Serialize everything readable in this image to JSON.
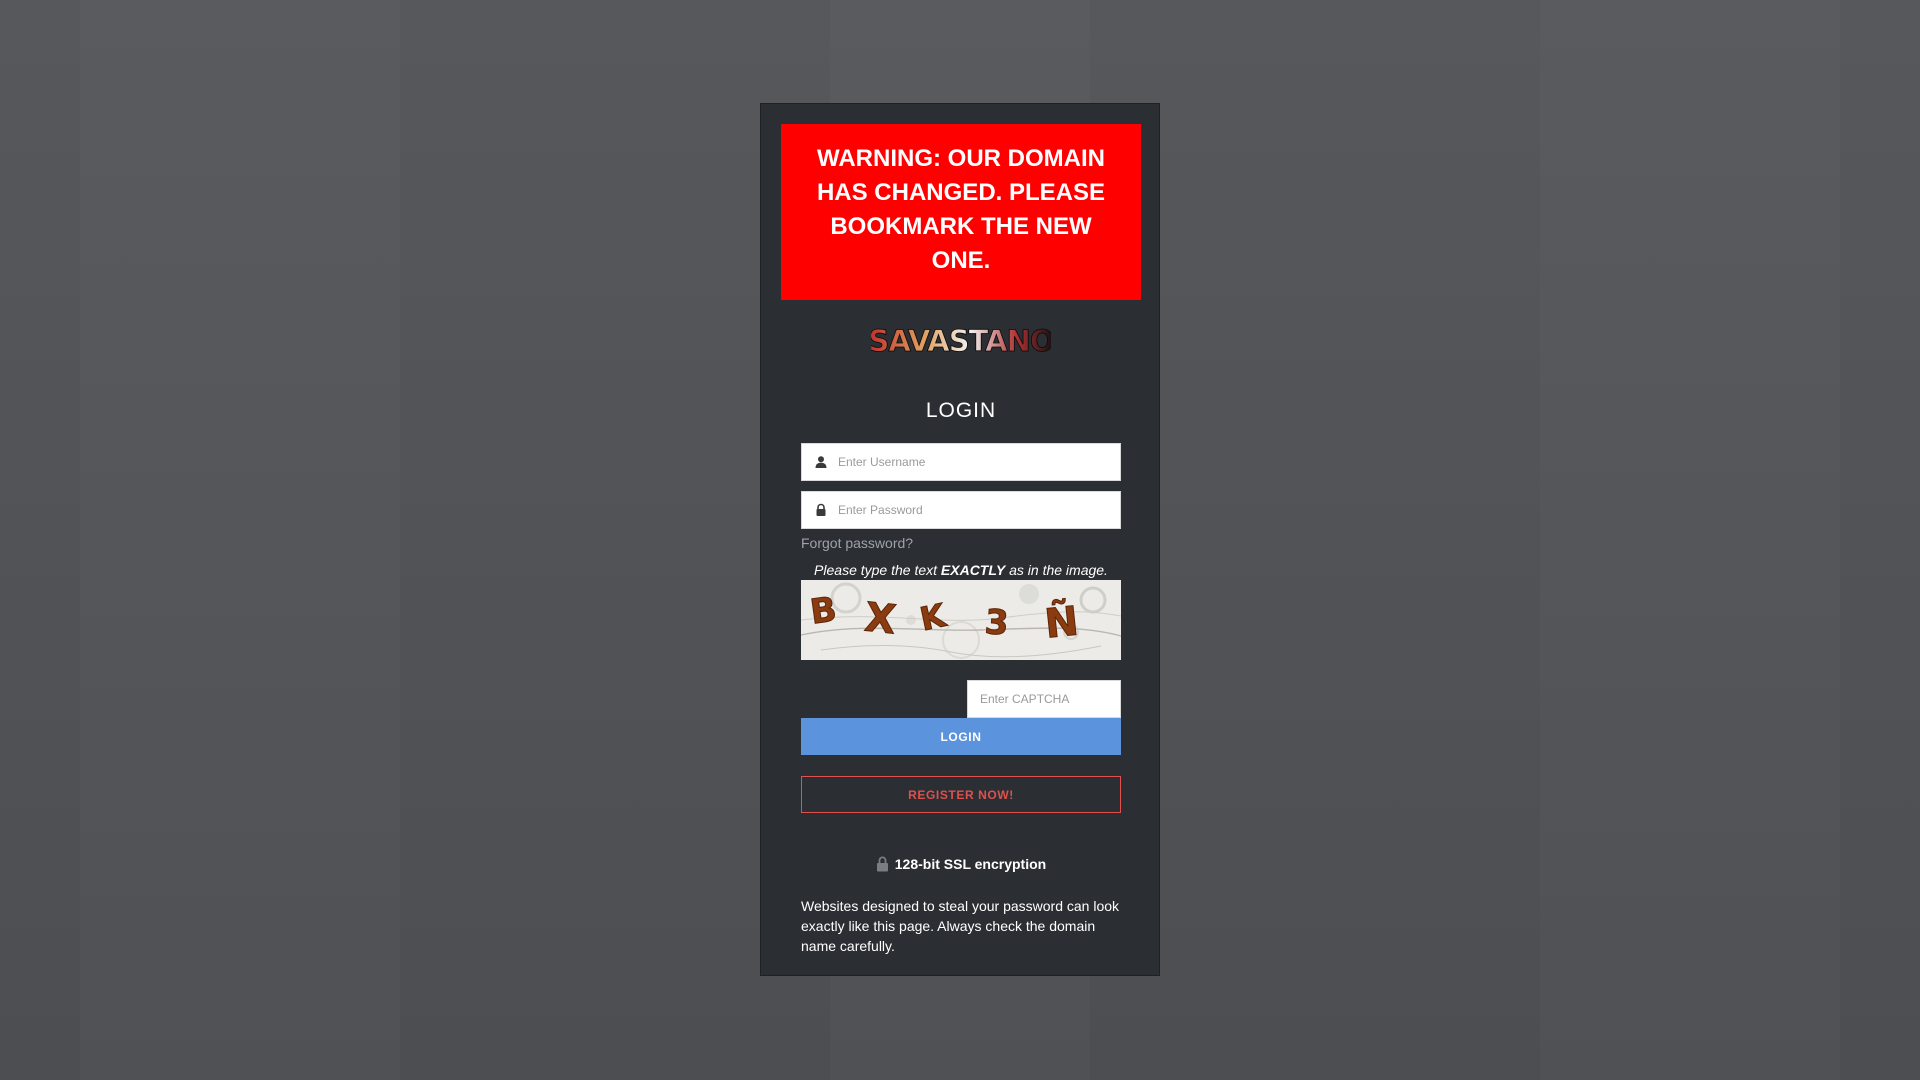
{
  "warning": {
    "text": "WARNING: OUR DOMAIN HAS CHANGED. PLEASE BOOKMARK THE NEW ONE."
  },
  "logo": {
    "text": "SAVASTANO"
  },
  "login_form": {
    "title": "LOGIN",
    "username": {
      "placeholder": "Enter Username",
      "value": "",
      "icon": "user-icon"
    },
    "password": {
      "placeholder": "Enter Password",
      "value": "",
      "icon": "lock-icon"
    },
    "forgot_label": "Forgot password?",
    "captcha": {
      "hint_prefix": "Please type the text",
      "hint_emphasis": "EXACTLY",
      "hint_suffix": "as in the image.",
      "characters": [
        "B",
        "X",
        "K",
        "3",
        "Ñ"
      ],
      "placeholder": "Enter CAPTCHA",
      "value": ""
    },
    "login_button": "LOGIN",
    "register_button": "REGISTER NOW!"
  },
  "security": {
    "ssl_label": "128-bit SSL encryption",
    "notice": "Websites designed to steal your password can look exactly like this page. Always check the domain name carefully."
  },
  "colors": {
    "page_background": "#525458",
    "card_background": "#2b2e33",
    "warning_red": "#ff0000",
    "login_blue": "#5b93dc",
    "register_red": "#e0504d",
    "captcha_letter": "#8a3b10"
  }
}
